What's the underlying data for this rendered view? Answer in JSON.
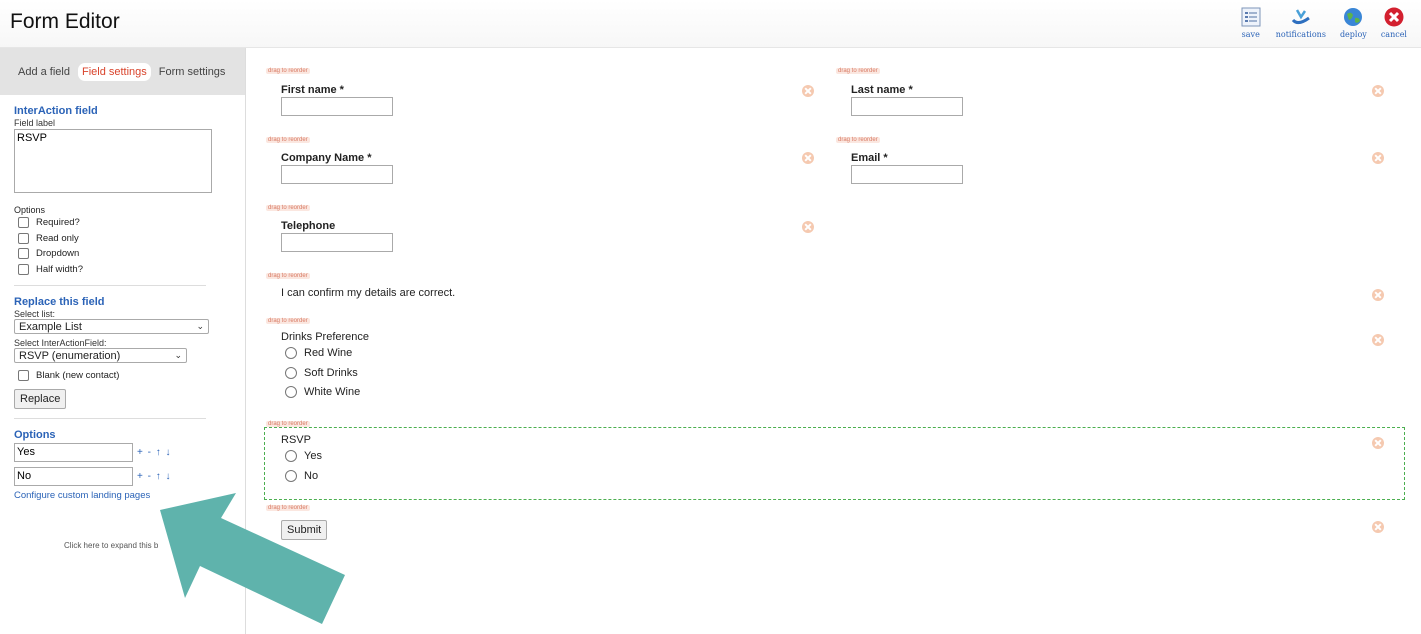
{
  "app": {
    "title": "Form Editor"
  },
  "toolbar": {
    "save": "save",
    "notifications": "notifications",
    "deploy": "deploy",
    "cancel": "cancel"
  },
  "sidebar": {
    "tabs": {
      "add": "Add a field",
      "field": "Field settings",
      "form": "Form settings"
    },
    "field_section": {
      "title": "InterAction field",
      "label_caption": "Field label",
      "label_value": "RSVP",
      "options_caption": "Options",
      "checkboxes": {
        "required": "Required?",
        "readonly": "Read only",
        "dropdown": "Dropdown",
        "half": "Half width?"
      }
    },
    "replace": {
      "title": "Replace this field",
      "list_caption": "Select list:",
      "list_value": "Example List",
      "field_caption": "Select InterActionField:",
      "field_value": "RSVP (enumeration)",
      "blank": "Blank (new contact)",
      "button": "Replace"
    },
    "options": {
      "title": "Options",
      "items": [
        "Yes",
        "No"
      ],
      "controls": "+ - ↑ ↓",
      "link": "Configure custom landing pages"
    },
    "expand_hint": "Click here to expand this b"
  },
  "canvas": {
    "drag_label": "drag to reorder",
    "first_name": "First name *",
    "last_name": "Last name *",
    "company": "Company Name *",
    "email": "Email *",
    "telephone": "Telephone",
    "confirm": "I can confirm my details are correct.",
    "drinks": {
      "label": "Drinks Preference",
      "options": [
        "Red Wine",
        "Soft Drinks",
        "White Wine"
      ]
    },
    "rsvp": {
      "label": "RSVP",
      "options": [
        "Yes",
        "No"
      ]
    },
    "submit": "Submit"
  },
  "colors": {
    "accent": "#2b63b7",
    "active_tab": "#d9432b",
    "arrow": "#5fb3ac",
    "selection": "#4caf50"
  },
  "icons": {
    "save": "form-list-icon",
    "notifications": "notification-icon",
    "deploy": "globe-icon",
    "cancel": "cancel-icon"
  }
}
